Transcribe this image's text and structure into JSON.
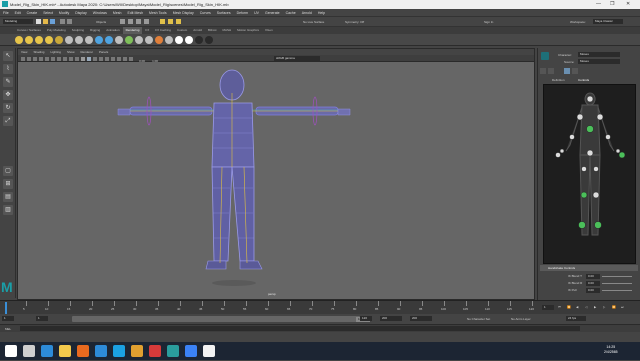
{
  "window": {
    "title": "Model_Rig_Skin_HIK.mb* - Autodesk Maya 2020: C:\\Users\\WII\\Desktop\\Maya\\Model_Rig\\scenes\\Model_Rig_Skin_HIK.mb",
    "minimize": "—",
    "maximize": "❐",
    "close": "✕"
  },
  "menubar": [
    "File",
    "Edit",
    "Create",
    "Select",
    "Modify",
    "Display",
    "Windows",
    "Mesh",
    "Edit Mesh",
    "Mesh Tools",
    "Mesh Display",
    "Curves",
    "Surfaces",
    "Deform",
    "UV",
    "Generate",
    "Cache",
    "Arnold",
    "Help"
  ],
  "statusline": {
    "menuset": "Modeling",
    "objects_label": "Objects",
    "live_surface": "No Live Surface",
    "symmetry": "Symmetry: Off",
    "signin": "Sign In",
    "workspace": "Workspace:",
    "workspace_value": "Maya Classic"
  },
  "shelf_tabs": [
    {
      "label": "Curves / Surfaces"
    },
    {
      "label": "Poly Modeling"
    },
    {
      "label": "Sculpting"
    },
    {
      "label": "Rigging"
    },
    {
      "label": "Animation"
    },
    {
      "label": "Rendering",
      "active": true
    },
    {
      "label": "FX"
    },
    {
      "label": "FX Caching"
    },
    {
      "label": "Custom"
    },
    {
      "label": "Arnold"
    },
    {
      "label": "Bifrost"
    },
    {
      "label": "MASH"
    },
    {
      "label": "Motion Graphics"
    },
    {
      "label": "XGen"
    }
  ],
  "shelf_icon_colors": [
    "#e6c44a",
    "#e6c44a",
    "#e6c44a",
    "#e6c44a",
    "#c9a83a",
    "#bfbfbf",
    "#bfbfbf",
    "#bfbfbf",
    "#4fa3e0",
    "#4fa3e0",
    "#bfbfbf",
    "#7fbf5a",
    "#bfbfbf",
    "#bfbfbf",
    "#e07f3a",
    "#bfbfbf",
    "#ffffff",
    "#ffffff",
    "#2a2a2a",
    "#2a2a2a"
  ],
  "viewport": {
    "menu": [
      "View",
      "Shading",
      "Lighting",
      "Show",
      "Renderer",
      "Panels"
    ],
    "camera_value": "sRGB gamma",
    "field_a": "0.00",
    "field_b": "1.00",
    "camera_label": "persp"
  },
  "hik": {
    "character_label": "Character:",
    "character_value": "Moses",
    "source_label": "Source:",
    "source_value": "Moses",
    "tab_definition": "Definition",
    "tab_controls": "Controls",
    "section_title": "Handshake Controls",
    "rows": [
      {
        "label": "IK Blend T",
        "value": "0.00"
      },
      {
        "label": "IK Blend R",
        "value": "0.00"
      },
      {
        "label": "IK Pull",
        "value": "0.00"
      }
    ]
  },
  "timeline": {
    "ticks": [
      "5",
      "10",
      "15",
      "20",
      "25",
      "30",
      "35",
      "40",
      "45",
      "50",
      "55",
      "60",
      "65",
      "70",
      "75",
      "80",
      "85",
      "90",
      "95",
      "100",
      "105",
      "110",
      "115",
      "120"
    ],
    "current_frame": "1"
  },
  "range": {
    "start": "1",
    "start_inner": "1",
    "range_handle": "120",
    "end_inner": "120",
    "end": "200",
    "end_outer": "200",
    "character_set": "No Character Set",
    "anim_layer": "No Anim Layer",
    "fps": "24 fps"
  },
  "cmdline": {
    "lang": "MEL"
  },
  "taskbar": {
    "time": "14:25",
    "date": "2/4/2565",
    "icon_colors": [
      "#ffffff",
      "#cfcfcf",
      "#2d8bd8",
      "#f2c94c",
      "#e86a1f",
      "#2d8bd8",
      "#1ba1e2",
      "#e0a030",
      "#d63a3a",
      "#2a9d9d",
      "#3b82f6",
      "#f2f2f2"
    ]
  }
}
